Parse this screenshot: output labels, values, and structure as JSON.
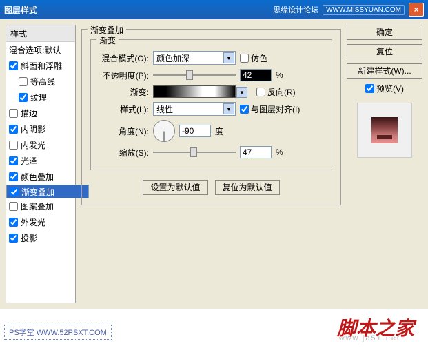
{
  "titlebar": {
    "title": "图层样式",
    "forum": "思缘设计论坛",
    "url": "WWW.MISSYUAN.COM",
    "close": "×"
  },
  "left": {
    "header": "样式",
    "blend": "混合选项:默认",
    "items": [
      {
        "label": "斜面和浮雕",
        "checked": true
      },
      {
        "label": "等高线",
        "checked": false,
        "indent": true
      },
      {
        "label": "纹理",
        "checked": true,
        "indent": true
      },
      {
        "label": "描边",
        "checked": false
      },
      {
        "label": "内阴影",
        "checked": true
      },
      {
        "label": "内发光",
        "checked": false
      },
      {
        "label": "光泽",
        "checked": true
      },
      {
        "label": "颜色叠加",
        "checked": true
      },
      {
        "label": "渐变叠加",
        "checked": true,
        "selected": true
      },
      {
        "label": "图案叠加",
        "checked": false
      },
      {
        "label": "外发光",
        "checked": true
      },
      {
        "label": "投影",
        "checked": true
      }
    ]
  },
  "center": {
    "group_title": "渐变叠加",
    "inner_title": "渐变",
    "blend_label": "混合模式(O):",
    "blend_value": "颜色加深",
    "dither": "仿色",
    "opacity_label": "不透明度(P):",
    "opacity_value": "42",
    "pct": "%",
    "gradient_label": "渐变:",
    "reverse": "反向(R)",
    "style_label": "样式(L):",
    "style_value": "线性",
    "align": "与图层对齐(I)",
    "angle_label": "角度(N):",
    "angle_value": "-90",
    "deg": "度",
    "scale_label": "缩放(S):",
    "scale_value": "47",
    "btn_default": "设置为默认值",
    "btn_reset": "复位为默认值"
  },
  "right": {
    "ok": "确定",
    "cancel": "复位",
    "new_style": "新建样式(W)...",
    "preview": "预览(V)"
  },
  "footer": {
    "wm1": "PS学堂  WWW.52PSXT.COM",
    "wm2": "脚本之家",
    "wm3": "www.jb51.net"
  }
}
